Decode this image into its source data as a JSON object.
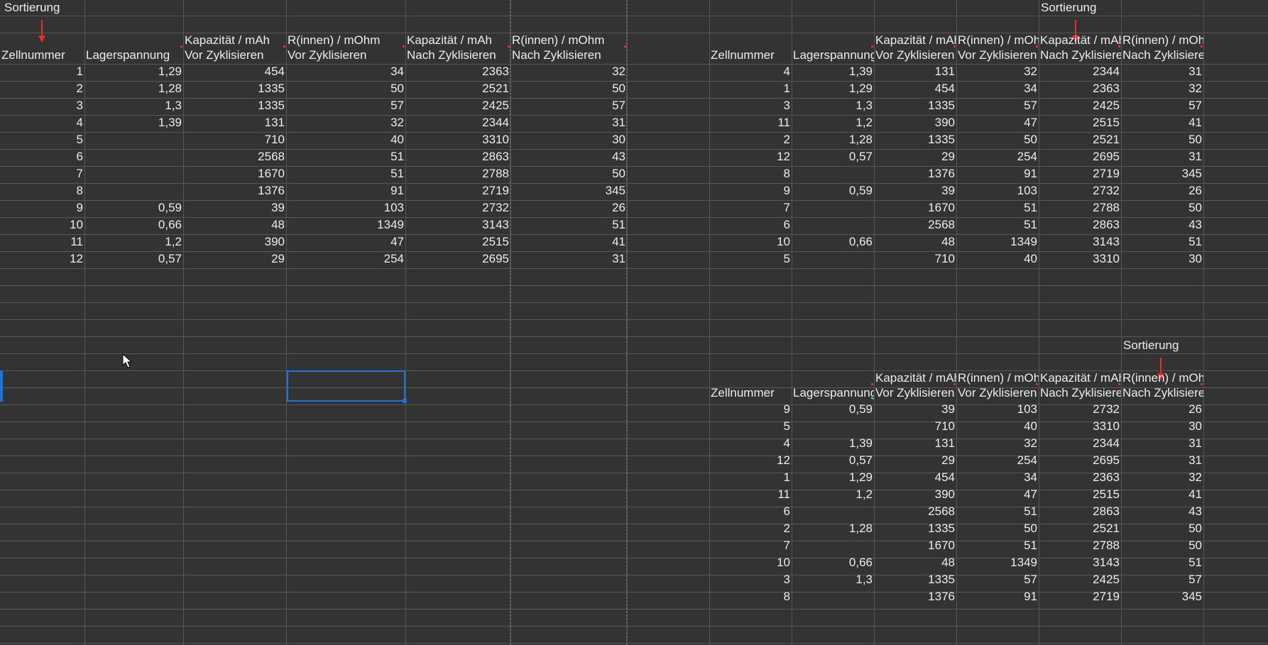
{
  "sheet": {
    "sort_label": "Sortierung",
    "tables": [
      {
        "headers": [
          [
            "Zellnummer",
            ""
          ],
          [
            "Lagerspannung",
            ""
          ],
          [
            "Kapazität / mAh",
            "Vor Zyklisieren"
          ],
          [
            "R(innen) / mOhm",
            "Vor Zyklisieren"
          ],
          [
            "Kapazität / mAh",
            "Nach Zyklisieren"
          ],
          [
            "R(innen) / mOhm",
            "Nach Zyklisieren"
          ]
        ],
        "rows": [
          [
            "1",
            "1,29",
            "454",
            "34",
            "2363",
            "32"
          ],
          [
            "2",
            "1,28",
            "1335",
            "50",
            "2521",
            "50"
          ],
          [
            "3",
            "1,3",
            "1335",
            "57",
            "2425",
            "57"
          ],
          [
            "4",
            "1,39",
            "131",
            "32",
            "2344",
            "31"
          ],
          [
            "5",
            "",
            "710",
            "40",
            "3310",
            "30"
          ],
          [
            "6",
            "",
            "2568",
            "51",
            "2863",
            "43"
          ],
          [
            "7",
            "",
            "1670",
            "51",
            "2788",
            "50"
          ],
          [
            "8",
            "",
            "1376",
            "91",
            "2719",
            "345"
          ],
          [
            "9",
            "0,59",
            "39",
            "103",
            "2732",
            "26"
          ],
          [
            "10",
            "0,66",
            "48",
            "1349",
            "3143",
            "51"
          ],
          [
            "11",
            "1,2",
            "390",
            "47",
            "2515",
            "41"
          ],
          [
            "12",
            "0,57",
            "29",
            "254",
            "2695",
            "31"
          ]
        ]
      },
      {
        "headers": [
          [
            "Zellnummer",
            ""
          ],
          [
            "Lagerspannung",
            ""
          ],
          [
            "Kapazität / mAh",
            "Vor Zyklisieren"
          ],
          [
            "R(innen) / mOhm",
            "Vor Zyklisieren"
          ],
          [
            "Kapazität / mAh",
            "Nach Zyklisieren"
          ],
          [
            "R(innen) / mOhm",
            "Nach Zyklisieren"
          ]
        ],
        "rows": [
          [
            "4",
            "1,39",
            "131",
            "32",
            "2344",
            "31"
          ],
          [
            "1",
            "1,29",
            "454",
            "34",
            "2363",
            "32"
          ],
          [
            "3",
            "1,3",
            "1335",
            "57",
            "2425",
            "57"
          ],
          [
            "11",
            "1,2",
            "390",
            "47",
            "2515",
            "41"
          ],
          [
            "2",
            "1,28",
            "1335",
            "50",
            "2521",
            "50"
          ],
          [
            "12",
            "0,57",
            "29",
            "254",
            "2695",
            "31"
          ],
          [
            "8",
            "",
            "1376",
            "91",
            "2719",
            "345"
          ],
          [
            "9",
            "0,59",
            "39",
            "103",
            "2732",
            "26"
          ],
          [
            "7",
            "",
            "1670",
            "51",
            "2788",
            "50"
          ],
          [
            "6",
            "",
            "2568",
            "51",
            "2863",
            "43"
          ],
          [
            "10",
            "0,66",
            "48",
            "1349",
            "3143",
            "51"
          ],
          [
            "5",
            "",
            "710",
            "40",
            "3310",
            "30"
          ]
        ]
      },
      {
        "headers": [
          [
            "Zellnummer",
            ""
          ],
          [
            "Lagerspannung",
            ""
          ],
          [
            "Kapazität / mAh",
            "Vor Zyklisieren"
          ],
          [
            "R(innen) / mOhm",
            "Vor Zyklisieren"
          ],
          [
            "Kapazität / mAh",
            "Nach Zyklisieren"
          ],
          [
            "R(innen) / mOhm",
            "Nach Zyklisieren"
          ]
        ],
        "rows": [
          [
            "9",
            "0,59",
            "39",
            "103",
            "2732",
            "26"
          ],
          [
            "5",
            "",
            "710",
            "40",
            "3310",
            "30"
          ],
          [
            "4",
            "1,39",
            "131",
            "32",
            "2344",
            "31"
          ],
          [
            "12",
            "0,57",
            "29",
            "254",
            "2695",
            "31"
          ],
          [
            "1",
            "1,29",
            "454",
            "34",
            "2363",
            "32"
          ],
          [
            "11",
            "1,2",
            "390",
            "47",
            "2515",
            "41"
          ],
          [
            "6",
            "",
            "2568",
            "51",
            "2863",
            "43"
          ],
          [
            "2",
            "1,28",
            "1335",
            "50",
            "2521",
            "50"
          ],
          [
            "7",
            "",
            "1670",
            "51",
            "2788",
            "50"
          ],
          [
            "10",
            "0,66",
            "48",
            "1349",
            "3143",
            "51"
          ],
          [
            "3",
            "1,3",
            "1335",
            "57",
            "2425",
            "57"
          ],
          [
            "8",
            "",
            "1376",
            "91",
            "2719",
            "345"
          ]
        ]
      }
    ],
    "colors": {
      "background": "#333333",
      "gridline": "#565656",
      "text": "#ececec",
      "arrow": "#e0302a",
      "selection": "#1c74d9"
    }
  }
}
